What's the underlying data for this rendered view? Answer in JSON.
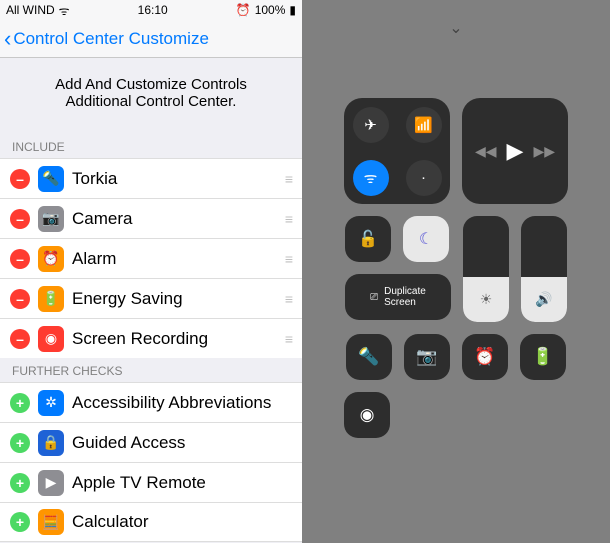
{
  "statusbar": {
    "carrier": "All WIND",
    "wifi": "ᯤ",
    "time": "16:10",
    "alarm": "⏰",
    "battery_pct": "100%",
    "battery_icon": "▮"
  },
  "navbar": {
    "back_chevron": "‹",
    "title": "Control Center Customize"
  },
  "intro": "Add And Customize Controls Additional Control Center.",
  "section_include": "INCLUDE",
  "section_further": "FURTHER CHECKS",
  "include_items": [
    {
      "icon": "🔦",
      "bg": "ic-blue",
      "label": "Torkia"
    },
    {
      "icon": "📷",
      "bg": "ic-gray",
      "label": "Camera"
    },
    {
      "icon": "⏰",
      "bg": "ic-orange",
      "label": "Alarm"
    },
    {
      "icon": "🔋",
      "bg": "ic-orange",
      "label": "Energy Saving"
    },
    {
      "icon": "◉",
      "bg": "ic-red",
      "label": "Screen Recording"
    }
  ],
  "further_items": [
    {
      "icon": "✲",
      "bg": "ic-blue",
      "label": "Accessibility Abbreviations"
    },
    {
      "icon": "🔒",
      "bg": "ic-dblue",
      "label": "Guided Access"
    },
    {
      "icon": "▶",
      "bg": "ic-gray",
      "label": "Apple TV Remote"
    },
    {
      "icon": "🧮",
      "bg": "ic-orange",
      "label": "Calculator"
    }
  ],
  "cc": {
    "grabber": "⌄",
    "airplane": "✈",
    "cellular": "📶",
    "wifi": "ᯤ",
    "bt": "·",
    "prev": "◀◀",
    "play": "▶",
    "next": "▶▶",
    "lock_rotation": "🔓",
    "dnd": "☾",
    "mirror_icon": "⎚",
    "mirror_label": "Duplicate\nScreen",
    "brightness": "☀",
    "volume": "🔊",
    "torch": "🔦",
    "camera": "📷",
    "alarm": "⏰",
    "battery": "🔋",
    "record": "◉"
  }
}
